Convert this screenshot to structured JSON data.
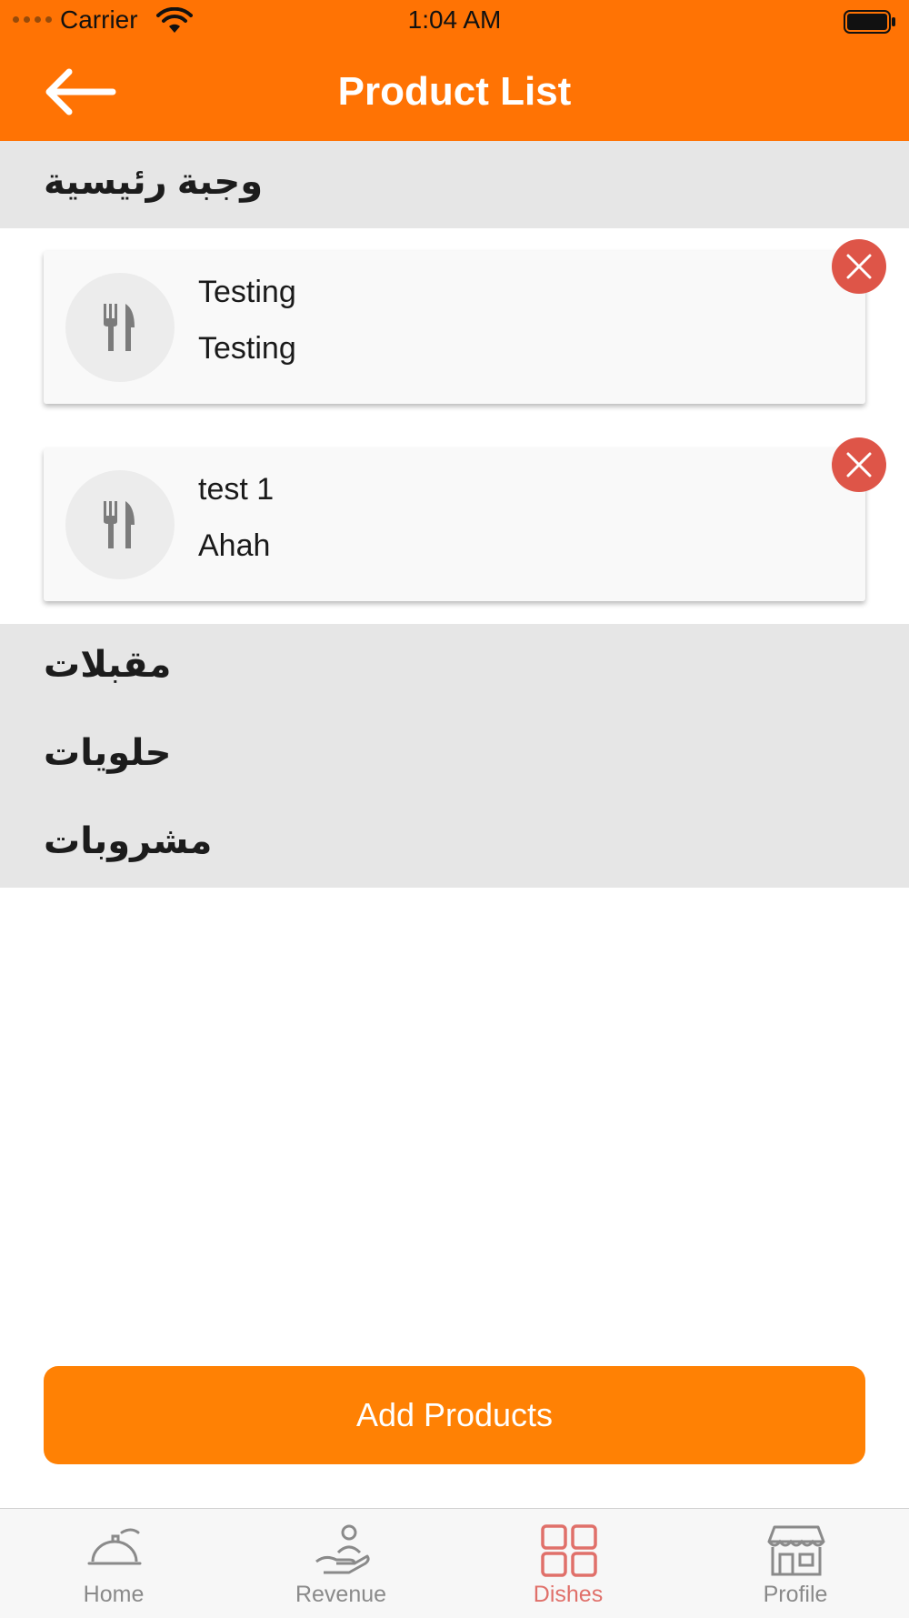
{
  "status_bar": {
    "carrier": "Carrier",
    "time": "1:04 AM"
  },
  "header": {
    "title": "Product List",
    "background": "#ff7304"
  },
  "sections": [
    {
      "label": "وجبة رئيسية",
      "products": [
        {
          "name": "Testing",
          "description": "Testing",
          "icon": "fork-knife-icon"
        },
        {
          "name": "test 1",
          "description": "Ahah",
          "icon": "fork-knife-icon"
        }
      ]
    },
    {
      "label": "مقبلات",
      "products": []
    },
    {
      "label": "حلويات",
      "products": []
    },
    {
      "label": "مشروبات",
      "products": []
    }
  ],
  "add_button": {
    "label": "Add Products",
    "color": "#ff8104"
  },
  "tab_bar": {
    "active_color": "#e0706a",
    "items": [
      {
        "label": "Home",
        "icon": "cloche-icon"
      },
      {
        "label": "Revenue",
        "icon": "hand-person-icon"
      },
      {
        "label": "Dishes",
        "icon": "grid-icon",
        "active": true
      },
      {
        "label": "Profile",
        "icon": "store-icon"
      }
    ]
  }
}
